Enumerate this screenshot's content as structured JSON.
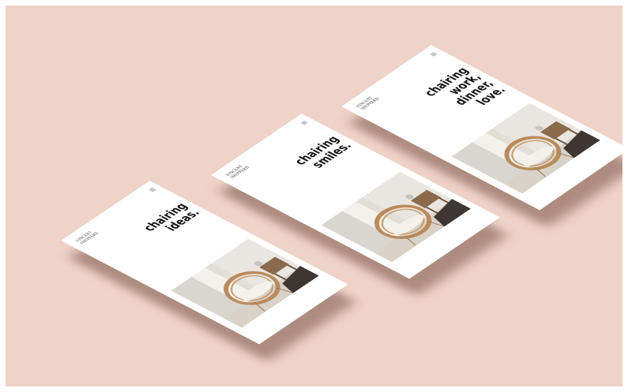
{
  "scene": {
    "description_colors": {
      "background": "#efd2c8",
      "card": "#ffffff",
      "text": "#111111"
    },
    "cards": [
      {
        "brand_line1": "VINCENT",
        "brand_line2": "SHEPPARD",
        "menu_icon": "hamburger-icon",
        "headline_lines": [
          "chairing",
          "ideas."
        ]
      },
      {
        "brand_line1": "VINCENT",
        "brand_line2": "SHEPPARD",
        "menu_icon": "hamburger-icon",
        "headline_lines": [
          "chairing",
          "smiles."
        ]
      },
      {
        "brand_line1": "VINCENT",
        "brand_line2": "SHEPPARD",
        "menu_icon": "hamburger-icon",
        "headline_lines": [
          "chairing",
          "work,",
          "dinner,",
          "love."
        ]
      }
    ]
  }
}
